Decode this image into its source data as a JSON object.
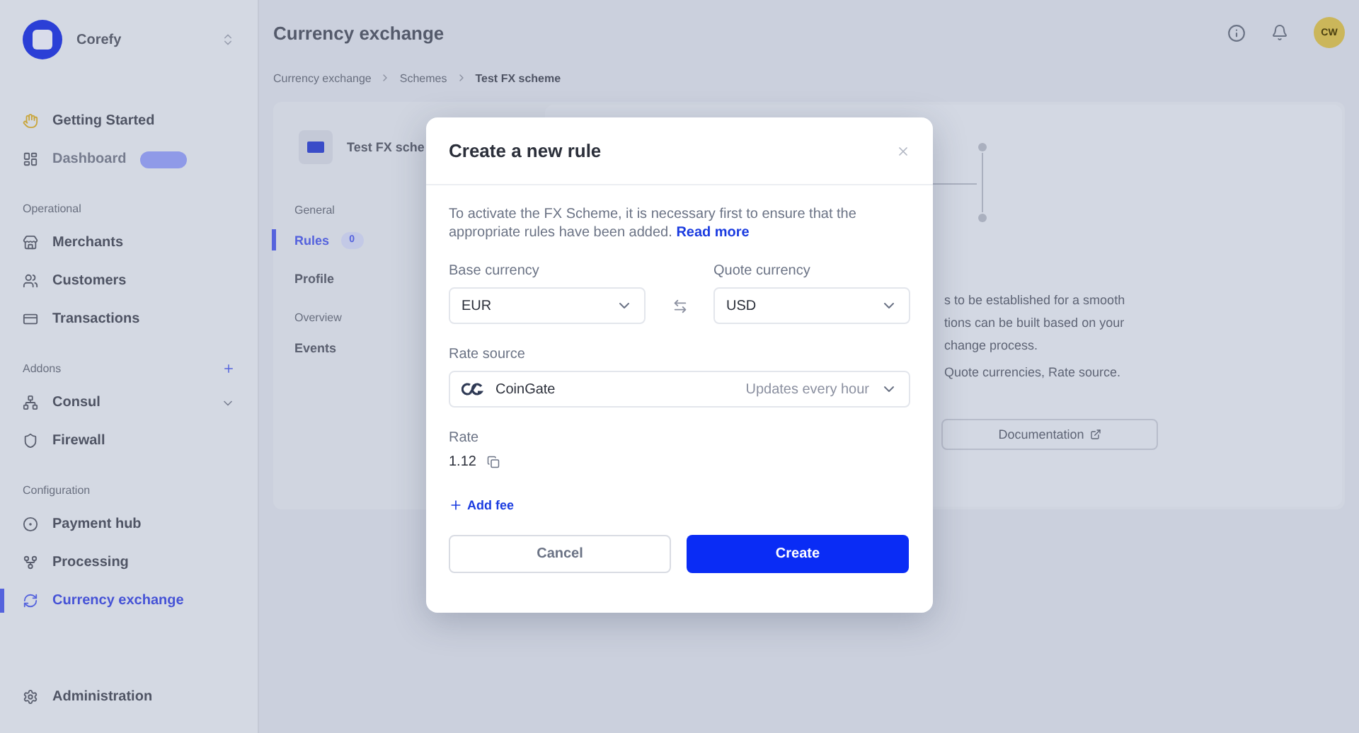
{
  "sidebar": {
    "brand": "Corefy",
    "items": [
      {
        "kind": "item",
        "label": "Getting Started",
        "selected": false,
        "disabled": false
      },
      {
        "kind": "item",
        "label": "Dashboard",
        "selected": false,
        "disabled": true,
        "badge": true
      },
      {
        "kind": "heading",
        "label": "Operational"
      },
      {
        "kind": "item",
        "label": "Merchants",
        "selected": false,
        "disabled": false
      },
      {
        "kind": "item",
        "label": "Customers",
        "selected": false,
        "disabled": false
      },
      {
        "kind": "item",
        "label": "Transactions",
        "selected": false,
        "disabled": false
      },
      {
        "kind": "heading",
        "label": "Addons",
        "add": true
      },
      {
        "kind": "item",
        "label": "Consul",
        "selected": false,
        "disabled": false,
        "expanded": false
      },
      {
        "kind": "item",
        "label": "Firewall",
        "selected": false,
        "disabled": false
      },
      {
        "kind": "heading",
        "label": "Configuration"
      },
      {
        "kind": "item",
        "label": "Payment hub",
        "selected": false,
        "disabled": false
      },
      {
        "kind": "item",
        "label": "Processing",
        "selected": false,
        "disabled": false
      },
      {
        "kind": "item",
        "label": "Currency exchange",
        "selected": true,
        "disabled": false
      }
    ],
    "footer": "Administration"
  },
  "header": {
    "title": "Currency exchange",
    "avatar": "CW"
  },
  "breadcrumbs": [
    "Currency exchange",
    "Schemes",
    "Test FX scheme"
  ],
  "scheme": {
    "name": "Test FX sche",
    "nav": [
      {
        "kind": "heading",
        "label": "General"
      },
      {
        "kind": "item",
        "label": "Rules",
        "selected": true,
        "count": "0"
      },
      {
        "kind": "item",
        "label": "Profile",
        "selected": false
      },
      {
        "kind": "heading",
        "label": "Overview"
      },
      {
        "kind": "item",
        "label": "Events",
        "selected": false
      }
    ]
  },
  "info": {
    "lines": [
      "s to be established for a smooth",
      "tions can be built based on your",
      "change process."
    ],
    "hint": "Quote currencies, Rate source.",
    "documentation": "Documentation"
  },
  "modal": {
    "title": "Create a new rule",
    "intro": "To activate the FX Scheme, it is necessary first to ensure that the appropriate rules have been added.",
    "link": "Read more",
    "base_currency": {
      "label": "Base currency",
      "value": "EUR"
    },
    "quote_currency": {
      "label": "Quote currency",
      "value": "USD"
    },
    "rate_source": {
      "label": "Rate source",
      "value": "CoinGate",
      "note": "Updates every hour"
    },
    "rate": {
      "label": "Rate",
      "value": "1.12"
    },
    "add_fee": "Add fee",
    "cancel": "Cancel",
    "create": "Create"
  }
}
